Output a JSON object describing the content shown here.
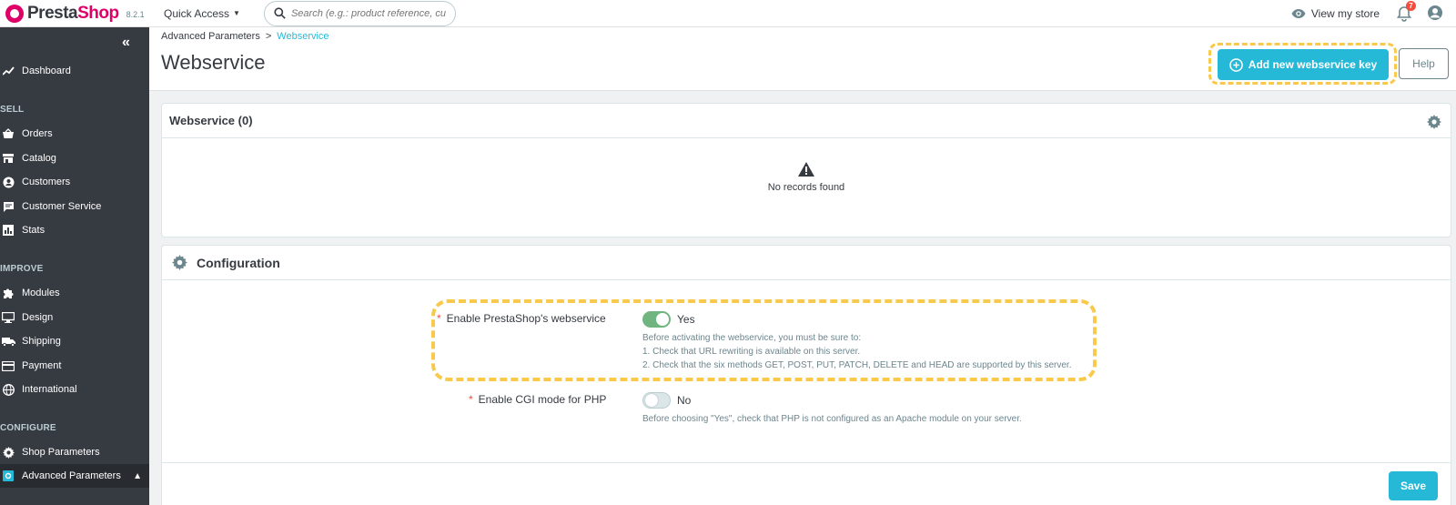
{
  "header": {
    "logo_text_a": "Presta",
    "logo_text_b": "Shop",
    "version": "8.2.1",
    "quick_access": "Quick Access",
    "search_placeholder": "Search (e.g.: product reference, custon",
    "view_store": "View my store",
    "notification_count": "7"
  },
  "sidebar": {
    "dashboard": "Dashboard",
    "sections": {
      "sell": "SELL",
      "improve": "IMPROVE",
      "configure": "CONFIGURE"
    },
    "sell_items": [
      "Orders",
      "Catalog",
      "Customers",
      "Customer Service",
      "Stats"
    ],
    "improve_items": [
      "Modules",
      "Design",
      "Shipping",
      "Payment",
      "International"
    ],
    "configure_items": [
      "Shop Parameters",
      "Advanced Parameters"
    ]
  },
  "breadcrumb": {
    "parent": "Advanced Parameters",
    "separator": ">",
    "current": "Webservice"
  },
  "page": {
    "title": "Webservice",
    "add_button": "Add new webservice key",
    "help_button": "Help"
  },
  "list_panel": {
    "title": "Webservice (0)",
    "empty_text": "No records found"
  },
  "config_panel": {
    "title": "Configuration",
    "fields": [
      {
        "label": "Enable PrestaShop's webservice",
        "value": "Yes",
        "help": [
          "Before activating the webservice, you must be sure to:",
          "1. Check that URL rewriting is available on this server.",
          "2. Check that the six methods GET, POST, PUT, PATCH, DELETE and HEAD are supported by this server."
        ]
      },
      {
        "label": "Enable CGI mode for PHP",
        "value": "No",
        "help": [
          "Before choosing \"Yes\", check that PHP is not configured as an Apache module on your server."
        ]
      }
    ],
    "save_button": "Save"
  },
  "colors": {
    "accent": "#25b9d7",
    "sidebar": "#363a41",
    "toggle_on": "#70b580",
    "highlight": "#f8c94b",
    "brand": "#df0067"
  }
}
